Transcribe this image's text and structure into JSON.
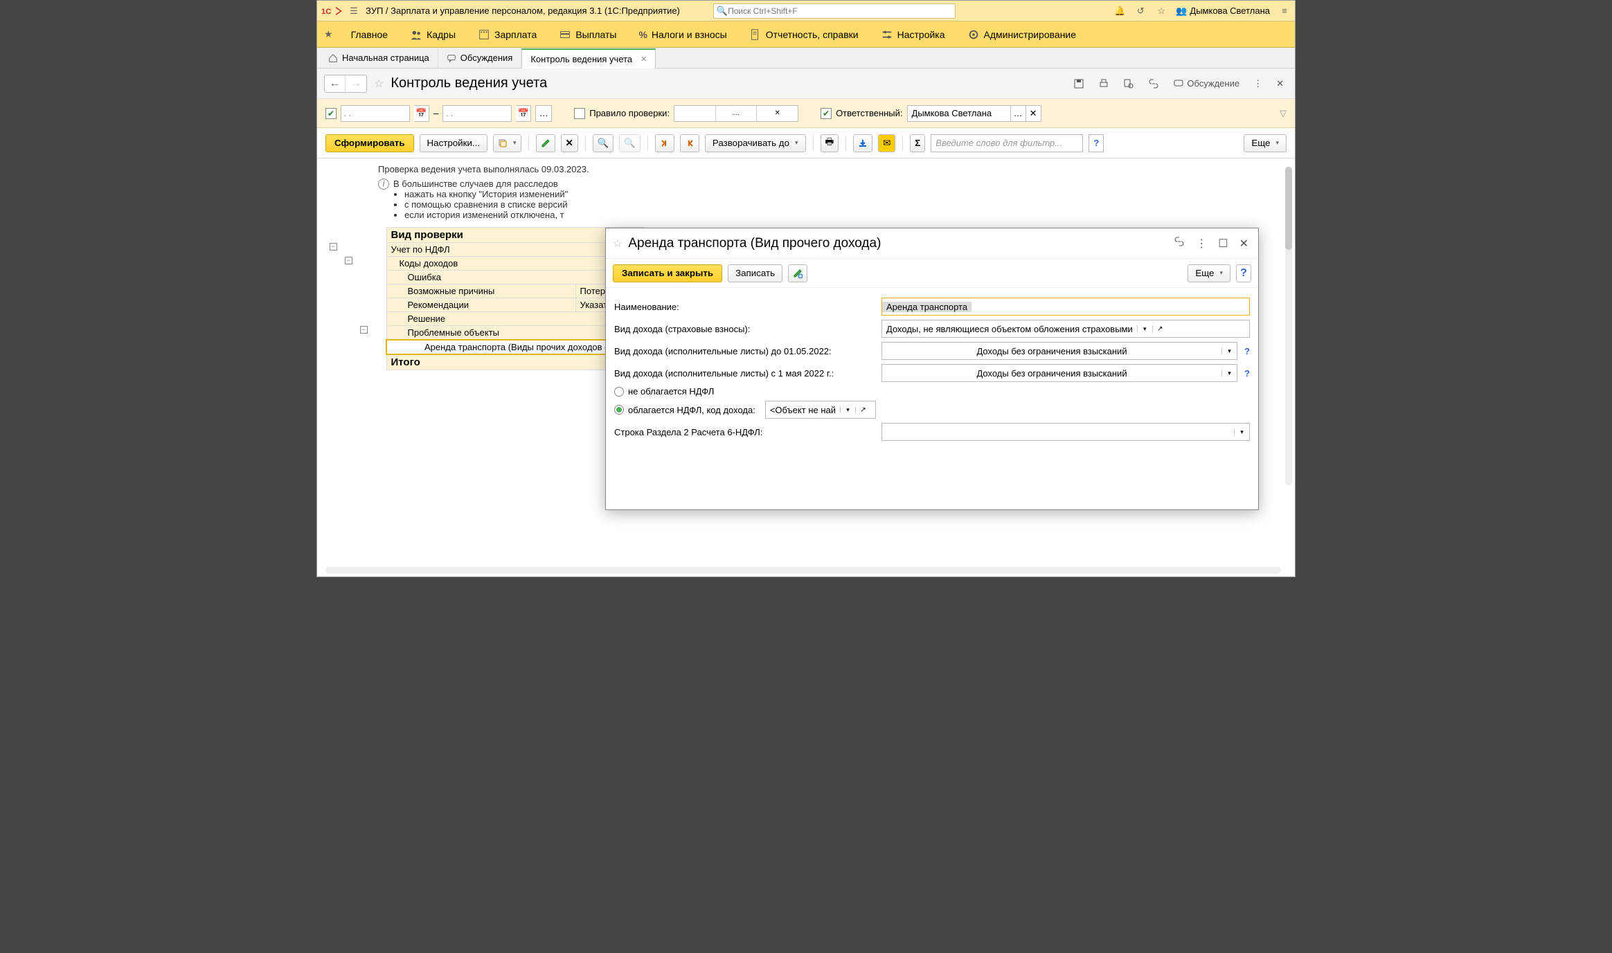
{
  "titlebar": {
    "app_title": "ЗУП / Зарплата и управление персоналом, редакция 3.1  (1С:Предприятие)",
    "search_placeholder": "Поиск Ctrl+Shift+F",
    "user_name": "Дымкова Светлана"
  },
  "menu": {
    "items": [
      "Главное",
      "Кадры",
      "Зарплата",
      "Выплаты",
      "Налоги и взносы",
      "Отчетность, справки",
      "Настройка",
      "Администрирование"
    ]
  },
  "tabs": {
    "home": "Начальная страница",
    "discussions": "Обсуждения",
    "active": "Контроль ведения учета"
  },
  "page": {
    "title": "Контроль ведения учета",
    "discussion_label": "Обсуждение"
  },
  "filters": {
    "date_from": ".  .",
    "date_to": ".  .",
    "dash": "–",
    "rule_label": "Правило проверки:",
    "resp_label": "Ответственный:",
    "resp_value": "Дымкова Светлана"
  },
  "cmdbar": {
    "generate": "Сформировать",
    "settings": "Настройки...",
    "expand_to": "Разворачивать до",
    "search_placeholder": "Введите слово для фильтр...",
    "more": "Еще"
  },
  "report": {
    "done_line": "Проверка ведения учета выполнялась 09.03.2023.",
    "hint_intro": "В большинстве случаев для расследов",
    "hint_1": "нажать на кнопку \"История изменений\"",
    "hint_2": "с помощью сравнения в списке версий",
    "hint_3": "если история изменений отключена, т",
    "check_type_hdr": "Вид проверки",
    "ndfl": "Учет по НДФЛ",
    "codes": "Коды доходов",
    "error": "Ошибка",
    "reasons": "Возможные причины",
    "reasons_val": "Потеря",
    "recom": "Рекомендации",
    "recom_val": "Указать",
    "solution": "Решение",
    "problem_obj": "Проблемные объекты",
    "problem_item": "Аренда транспорта (Виды прочих доходов физлиц)",
    "total": "Итого"
  },
  "dialog": {
    "title": "Аренда транспорта (Вид прочего дохода)",
    "write_close": "Записать и закрыть",
    "write": "Записать",
    "more": "Еще",
    "name_lbl": "Наименование:",
    "name_val": "Аренда транспорта",
    "ins_lbl": "Вид дохода (страховые взносы):",
    "ins_val": "Доходы, не являющиеся объектом обложения страховыми",
    "exec1_lbl": "Вид дохода (исполнительные листы) до 01.05.2022:",
    "exec1_val": "Доходы без ограничения взысканий",
    "exec2_lbl": "Вид дохода (исполнительные листы) с 1 мая 2022 г.:",
    "exec2_val": "Доходы без ограничения взысканий",
    "radio_notax": "не облагается НДФЛ",
    "radio_tax": "облагается НДФЛ, код дохода:",
    "tax_code_val": "<Объект не най",
    "section2_lbl": "Строка Раздела 2 Расчета 6-НДФЛ:"
  }
}
